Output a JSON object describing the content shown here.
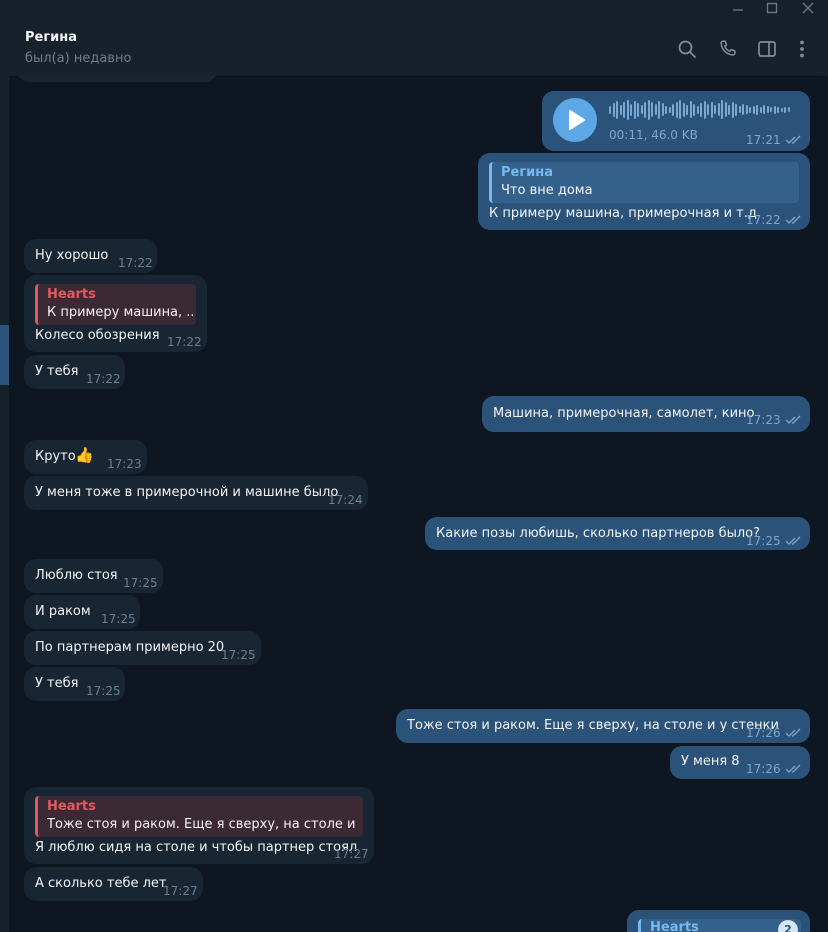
{
  "window": {
    "minimize_icon": "minimize-icon",
    "maximize_icon": "maximize-icon",
    "close_icon": "close-icon"
  },
  "header": {
    "name": "Регина",
    "status": "был(а) недавно",
    "icons": [
      "search-icon",
      "phone-icon",
      "sidebar-icon",
      "more-vertical-icon"
    ]
  },
  "colors": {
    "background": "#0e1621",
    "header": "#17212b",
    "incoming_bubble": "#182533",
    "outgoing_bubble": "#2b5278",
    "reply_name_incoming": "#e4595d",
    "reply_name_outgoing": "#7ab8f0"
  },
  "messages": [
    {
      "dir": "out",
      "type": "voice",
      "meta": "00:11, 46.0 KB",
      "time": "17:21",
      "read": true
    },
    {
      "dir": "out",
      "reply": {
        "name": "Регина",
        "text": "Что вне дома"
      },
      "text": "К примеру машина, примерочная и т.д",
      "time": "17:22",
      "read": true
    },
    {
      "dir": "in",
      "text": "Ну хорошо",
      "time": "17:22"
    },
    {
      "dir": "in",
      "reply": {
        "name": "Hearts",
        "text": "К примеру машина, ..."
      },
      "text": "Колесо обозрения",
      "time": "17:22"
    },
    {
      "dir": "in",
      "text": "У тебя",
      "time": "17:22"
    },
    {
      "dir": "out",
      "text": "Машина, примерочная, самолет, кино",
      "time": "17:23",
      "read": true
    },
    {
      "dir": "in",
      "text": "Круто",
      "emoji": "👍",
      "time": "17:23"
    },
    {
      "dir": "in",
      "text": "У меня тоже в примерочной и машине было",
      "time": "17:24"
    },
    {
      "dir": "out",
      "text": "Какие позы любишь, сколько партнеров было?",
      "time": "17:25",
      "read": true
    },
    {
      "dir": "in",
      "text": "Люблю стоя",
      "time": "17:25"
    },
    {
      "dir": "in",
      "text": "И раком",
      "time": "17:25"
    },
    {
      "dir": "in",
      "text": "По партнерам примерно 20",
      "time": "17:25"
    },
    {
      "dir": "in",
      "text": "У тебя",
      "time": "17:25"
    },
    {
      "dir": "out",
      "text": "Тоже стоя и раком. Еще я сверху, на столе и у стенки",
      "time": "17:26",
      "read": true
    },
    {
      "dir": "out",
      "text": "У меня 8",
      "time": "17:26",
      "read": true
    },
    {
      "dir": "in",
      "reply": {
        "name": "Hearts",
        "text": "Тоже стоя и раком. Еще я сверху, на столе и у ст..."
      },
      "text": "Я люблю сидя на столе и чтобы партнер стоял",
      "time": "17:27"
    },
    {
      "dir": "in",
      "text": "А сколько тебе лет",
      "time": "17:27"
    },
    {
      "dir": "out",
      "reply": {
        "name": "Hearts"
      },
      "badge": "2"
    }
  ]
}
